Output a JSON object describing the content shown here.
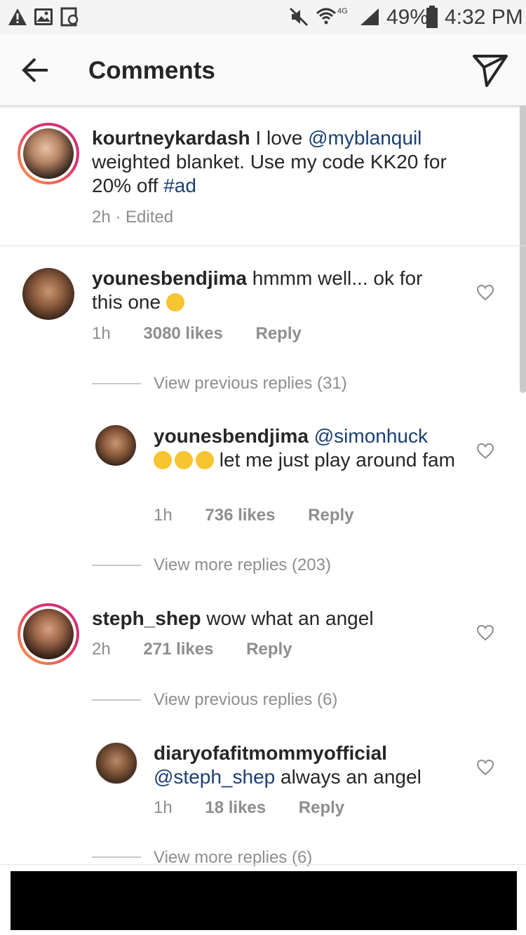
{
  "status_bar": {
    "battery": "49%",
    "time": "4:32 PM",
    "network": "4G",
    "icons": [
      "warning-icon",
      "image-icon",
      "sync-icon",
      "mute-icon",
      "wifi-icon",
      "signal-icon",
      "battery-icon"
    ]
  },
  "header": {
    "title": "Comments",
    "back_icon": "arrow-left-icon",
    "send_icon": "paper-plane-icon"
  },
  "caption": {
    "username": "kourtneykardash",
    "text_before": " I love ",
    "mention": "@myblanquil",
    "text_after": " weighted blanket. Use my code KK20 for 20% off ",
    "hashtag": "#ad",
    "meta": "2h · Edited"
  },
  "comments": [
    {
      "username": "younesbendjima",
      "text": " hmmm well... ok for this one ",
      "emoji": "squinting-face-with-tongue",
      "time": "1h",
      "likes": "3080 likes",
      "reply": "Reply",
      "thread": "View previous replies (31)"
    },
    {
      "username": "younesbendjima",
      "mention": "@simonhuck",
      "text": " let me just play around fam",
      "emoji": "rolling-on-floor-laughing x3",
      "time": "1h",
      "likes": "736 likes",
      "reply": "Reply",
      "thread": "View more replies (203)"
    },
    {
      "username": "steph_shep",
      "text": " wow what an angel",
      "time": "2h",
      "likes": "271 likes",
      "reply": "Reply",
      "thread": "View previous replies (6)"
    },
    {
      "username": "diaryofafitmommyofficial",
      "mention": "@steph_shep",
      "text": " always an angel",
      "time": "1h",
      "likes": "18 likes",
      "reply": "Reply",
      "thread": "View more replies (6)"
    }
  ],
  "colors": {
    "link": "#1b3f73",
    "meta": "#8e8e8e",
    "story_ring": "#e1306c"
  }
}
